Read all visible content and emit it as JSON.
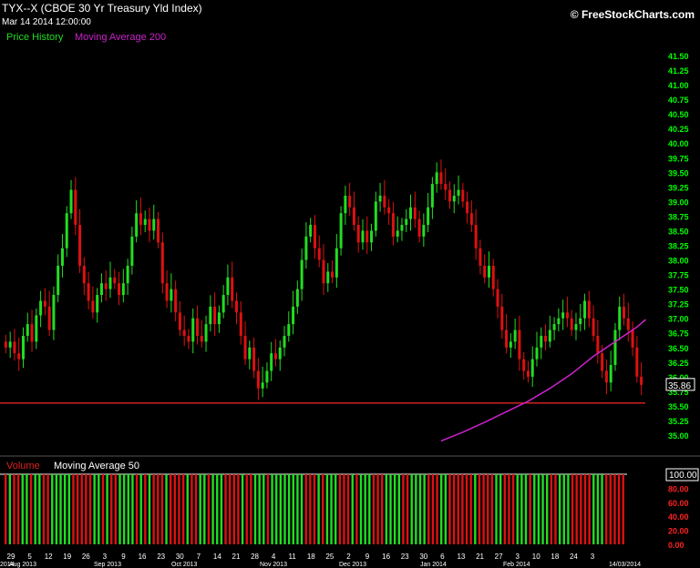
{
  "header": {
    "title": "TYX--X (CBOE 30 Yr Treasury Yld Index)",
    "datetime": "Mar 14 2014 12:00:00",
    "brand": "© FreeStockCharts.com",
    "legend_price": "Price History",
    "legend_ma": "Moving Average 200"
  },
  "colors": {
    "background": "#000000",
    "up": "#22dd22",
    "down": "#dd1111",
    "ma": "#cc22cc",
    "axis_text": "#00ff00",
    "volume_axis_text": "#ff2222",
    "hline": "#cc2222",
    "text": "#ffffff"
  },
  "chart_data": [
    {
      "type": "candlestick",
      "title": "TYX--X (CBOE 30 Yr Treasury Yld Index)",
      "ylim": [
        34.6,
        41.6
      ],
      "y_ticks": [
        "41.50",
        "41.25",
        "41.00",
        "40.75",
        "40.50",
        "40.25",
        "40.00",
        "39.75",
        "39.50",
        "39.25",
        "39.00",
        "38.75",
        "38.50",
        "38.25",
        "38.00",
        "37.75",
        "37.50",
        "37.25",
        "37.00",
        "36.75",
        "36.50",
        "36.25",
        "36.00",
        "35.75",
        "35.50",
        "35.25",
        "35.00"
      ],
      "last_value_label": "35.86",
      "last_value": 35.86,
      "horizontal_line": 35.55,
      "series": [
        {
          "name": "Price History",
          "values": [
            36.5,
            36.6,
            36.4,
            36.3,
            36.7,
            36.9,
            36.6,
            37.05,
            37.3,
            37.2,
            36.8,
            37.4,
            37.9,
            38.2,
            38.8,
            39.2,
            38.6,
            37.9,
            37.6,
            37.3,
            37.1,
            37.4,
            37.6,
            37.5,
            37.7,
            37.6,
            37.4,
            37.6,
            37.9,
            38.4,
            38.8,
            38.6,
            38.7,
            38.5,
            38.7,
            38.3,
            37.6,
            37.3,
            37.5,
            37.1,
            36.8,
            36.7,
            36.6,
            37.0,
            36.7,
            36.6,
            36.9,
            37.2,
            36.9,
            37.1,
            37.4,
            37.7,
            37.3,
            37.1,
            36.7,
            36.3,
            36.5,
            36.1,
            35.8,
            35.9,
            36.1,
            36.4,
            36.3,
            36.5,
            36.7,
            36.9,
            37.2,
            37.5,
            38.0,
            38.4,
            38.6,
            38.2,
            38.0,
            37.6,
            37.8,
            37.7,
            38.2,
            38.8,
            39.1,
            38.9,
            38.6,
            38.3,
            38.5,
            38.3,
            38.5,
            39.0,
            39.1,
            38.9,
            38.8,
            38.4,
            38.5,
            38.6,
            38.7,
            38.9,
            38.7,
            38.4,
            38.6,
            38.9,
            39.3,
            39.5,
            39.3,
            39.2,
            39.0,
            39.1,
            39.2,
            39.0,
            38.8,
            38.6,
            38.2,
            37.9,
            37.7,
            37.9,
            37.5,
            37.2,
            36.8,
            36.5,
            36.6,
            36.8,
            36.3,
            36.1,
            36.0,
            36.3,
            36.5,
            36.7,
            36.6,
            36.8,
            36.9,
            37.0,
            37.1,
            37.0,
            36.8,
            36.9,
            37.0,
            37.3,
            37.0,
            36.7,
            36.4,
            36.1,
            35.9,
            36.2,
            36.8,
            37.2,
            37.0,
            36.8,
            36.5,
            36.0,
            35.86
          ]
        },
        {
          "name": "Moving Average 200",
          "x_index": [
            100,
            105,
            110,
            115,
            120,
            125,
            130,
            135,
            140,
            145,
            147
          ],
          "values": [
            34.9,
            35.05,
            35.22,
            35.4,
            35.58,
            35.8,
            36.05,
            36.35,
            36.6,
            36.85,
            36.98
          ]
        }
      ],
      "x_axis": {
        "day_ticks": [
          "29",
          "5",
          "12",
          "19",
          "26",
          "3",
          "9",
          "16",
          "23",
          "30",
          "7",
          "14",
          "21",
          "28",
          "4",
          "11",
          "18",
          "25",
          "2",
          "9",
          "16",
          "23",
          "30",
          "6",
          "13",
          "21",
          "27",
          "3",
          "10",
          "18",
          "24",
          "3"
        ],
        "month_labels": [
          "2014",
          "Aug 2013",
          "Sep 2013",
          "Oct 2013",
          "Nov 2013",
          "Dec 2013",
          "Jan 2014",
          "Feb 2014",
          "14/03/2014"
        ]
      }
    },
    {
      "type": "bar",
      "title": "Volume",
      "legend_ma": "Moving Average 50",
      "ylim": [
        0,
        100
      ],
      "y_ticks": [
        "100.00",
        "80.00",
        "60.00",
        "40.00",
        "20.00",
        "0.00"
      ],
      "last_value_label": "100.00",
      "values_all": 100
    }
  ]
}
